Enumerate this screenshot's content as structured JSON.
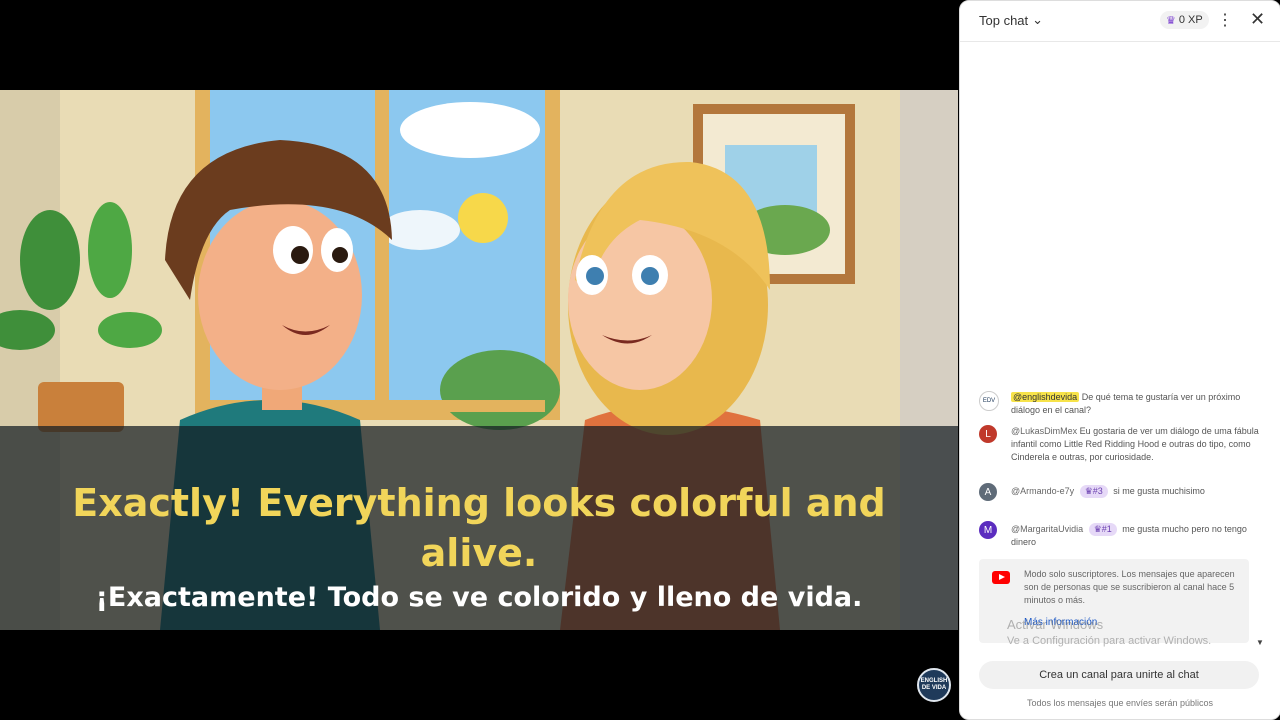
{
  "video": {
    "subtitle_en": "Exactly! Everything looks colorful and alive.",
    "subtitle_es": "¡Exactamente! Todo se ve colorido y lleno de vida.",
    "channel_logo_text": "ENGLISH DE VIDA"
  },
  "chat": {
    "mode_label": "Top chat",
    "xp_label": "0 XP",
    "messages": [
      {
        "author": "@englishdevida",
        "avatar_letter": "",
        "avatar_color": "#ffffff",
        "badge": "",
        "text": "De qué tema te gustaría ver un próximo diálogo en el canal?"
      },
      {
        "author": "@LukasDimMex",
        "avatar_letter": "L",
        "avatar_color": "#c0392b",
        "badge": "",
        "text": "Eu gostaria de ver um diálogo de uma fábula infantil como Little Red Ridding Hood e outras do tipo, como Cinderela e outras, por curiosidade."
      },
      {
        "author": "@Armando-e7y",
        "avatar_letter": "A",
        "avatar_color": "#5f6b78",
        "badge": "#3",
        "text": "si me gusta muchisimo"
      },
      {
        "author": "@MargaritaUvidia",
        "avatar_letter": "M",
        "avatar_color": "#5b2dbf",
        "badge": "#1",
        "text": "me gusta mucho pero no tengo dinero"
      }
    ],
    "notice": {
      "text": "Modo solo suscriptores. Los mensajes que aparecen son de personas que se suscribieron al canal hace 5 minutos o más.",
      "link": "Más información"
    },
    "watermark": {
      "line1": "Activar Windows",
      "line2": "Ve a Configuración para activar Windows."
    },
    "join_button": "Crea un canal para unirte al chat",
    "footer_note": "Todos los mensajes que envíes serán públicos"
  },
  "colors": {
    "subtitle_en": "#f1d55a",
    "subtitle_es": "#ffffff",
    "owner_highlight": "#f7e34a",
    "badge_bg": "#e6d9f7",
    "link": "#1a56c4"
  }
}
